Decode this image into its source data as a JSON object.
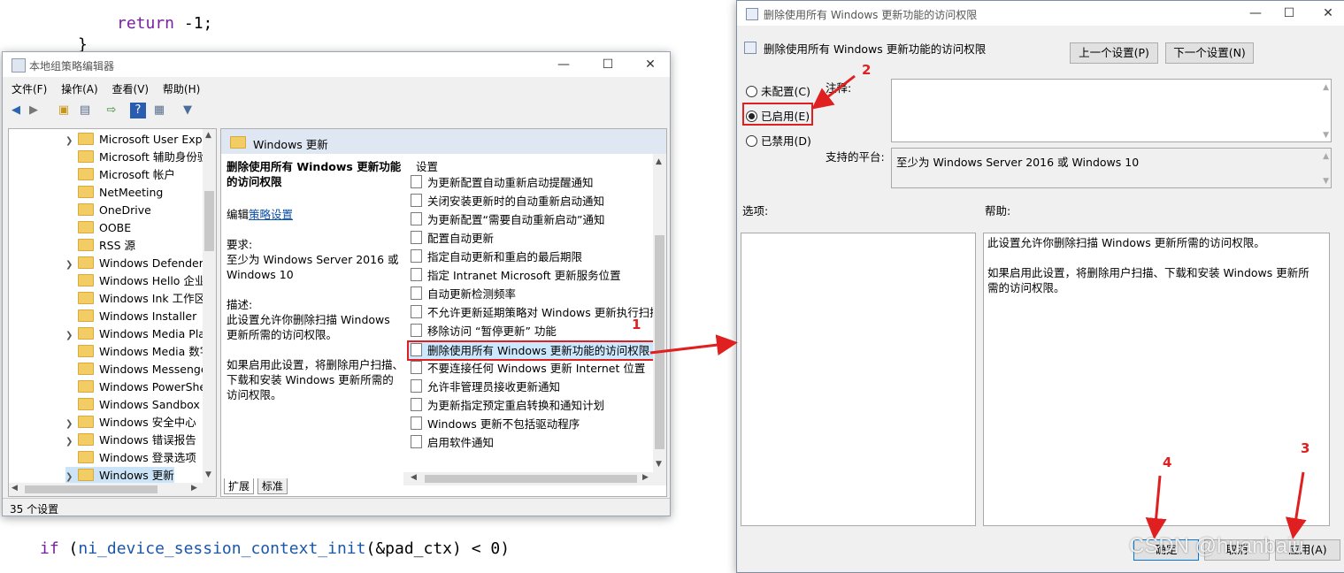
{
  "code": {
    "line1": "return -1;",
    "line1_kw": "return",
    "line1_rest": " -1;",
    "line2_kw": "if",
    "line2_fn": "ni_device_session_context_init",
    "line2_rest": "(&pad_ctx) < 0)",
    "brace": "}"
  },
  "gpedit": {
    "title": "本地组策略编辑器",
    "menu": [
      "文件(F)",
      "操作(A)",
      "查看(V)",
      "帮助(H)"
    ],
    "tree": [
      {
        "label": "Microsoft User Expe",
        "arrow": true
      },
      {
        "label": "Microsoft 辅助身份验",
        "arrow": false
      },
      {
        "label": "Microsoft 帐户",
        "arrow": false
      },
      {
        "label": "NetMeeting",
        "arrow": false
      },
      {
        "label": "OneDrive",
        "arrow": false
      },
      {
        "label": "OOBE",
        "arrow": false
      },
      {
        "label": "RSS 源",
        "arrow": false
      },
      {
        "label": "Windows Defender",
        "arrow": true
      },
      {
        "label": "Windows Hello 企业",
        "arrow": false
      },
      {
        "label": "Windows Ink 工作区",
        "arrow": false
      },
      {
        "label": "Windows Installer",
        "arrow": false
      },
      {
        "label": "Windows Media Pla",
        "arrow": true
      },
      {
        "label": "Windows Media 数字",
        "arrow": false
      },
      {
        "label": "Windows Messenge",
        "arrow": false
      },
      {
        "label": "Windows PowerShe",
        "arrow": false
      },
      {
        "label": "Windows Sandbox",
        "arrow": false
      },
      {
        "label": "Windows 安全中心",
        "arrow": true
      },
      {
        "label": "Windows 错误报告",
        "arrow": true
      },
      {
        "label": "Windows 登录选项",
        "arrow": false
      },
      {
        "label": "Windows 更新",
        "arrow": true
      }
    ],
    "pane_header": "Windows 更新",
    "desc_title": "删除使用所有 Windows 更新功能的访问权限",
    "edit_prefix": "编辑",
    "edit_link": "策略设置",
    "req_label": "要求:",
    "req_text": "至少为 Windows Server 2016 或 Windows 10",
    "desc_label": "描述:",
    "desc_text1": "此设置允许你删除扫描 Windows 更新所需的访问权限。",
    "desc_text2": "如果启用此设置，将删除用户扫描、下载和安装 Windows 更新所需的访问权限。",
    "list_header": "设置",
    "settings": [
      "为更新配置自动重新启动提醒通知",
      "关闭安装更新时的自动重新启动通知",
      "为更新配置“需要自动重新启动”通知",
      "配置自动更新",
      "指定自动更新和重启的最后期限",
      "指定 Intranet Microsoft 更新服务位置",
      "自动更新检测频率",
      "不允许更新延期策略对 Windows 更新执行扫描",
      "移除访问 “暂停更新” 功能",
      "删除使用所有 Windows 更新功能的访问权限",
      "不要连接任何 Windows 更新 Internet 位置",
      "允许非管理员接收更新通知",
      "为更新指定预定重启转换和通知计划",
      "Windows 更新不包括驱动程序",
      "启用软件通知"
    ],
    "tabs": [
      "扩展",
      "标准"
    ],
    "status": "35 个设置"
  },
  "dialog": {
    "title": "删除使用所有 Windows 更新功能的访问权限",
    "heading": "删除使用所有 Windows 更新功能的访问权限",
    "prev_btn": "上一个设置(P)",
    "next_btn": "下一个设置(N)",
    "radio_notconfigured": "未配置(C)",
    "radio_enabled": "已启用(E)",
    "radio_disabled": "已禁用(D)",
    "comment_label": "注释:",
    "platform_label": "支持的平台:",
    "platform_text": "至少为 Windows Server 2016 或 Windows 10",
    "options_label": "选项:",
    "help_label": "帮助:",
    "help_text1": "此设置允许你删除扫描 Windows 更新所需的访问权限。",
    "help_text2": "如果启用此设置，将删除用户扫描、下载和安装 Windows 更新所需的访问权限。",
    "ok_btn": "确定",
    "cancel_btn": "取消",
    "apply_btn": "应用(A)"
  },
  "annotations": {
    "n1": "1",
    "n2": "2",
    "n3": "3",
    "n4": "4",
    "accent": "#e02020"
  },
  "watermark": "CSDN @huanbaiu"
}
